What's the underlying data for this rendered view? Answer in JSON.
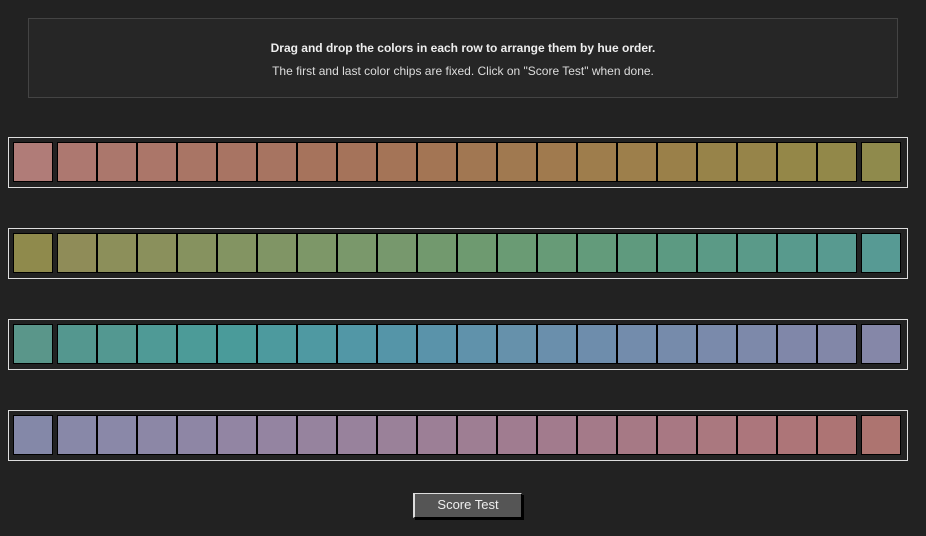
{
  "instructions": {
    "title": "Drag and drop the colors in each row to arrange them by hue order.",
    "subtitle": "The first and last color chips are fixed. Click on \"Score Test\" when done."
  },
  "rows": [
    {
      "chips": [
        "#b07c78",
        "#ad7870",
        "#ab776c",
        "#ab7669",
        "#a97565",
        "#a87463",
        "#a77461",
        "#a6735c",
        "#a5735a",
        "#a47457",
        "#a37554",
        "#a17752",
        "#a07950",
        "#a07a4e",
        "#9e7d4c",
        "#9d7f4b",
        "#9a8049",
        "#978349",
        "#968449",
        "#948748",
        "#928849",
        "#8f8a4c"
      ]
    },
    {
      "chips": [
        "#8f8a4c",
        "#8f8c58",
        "#8c8f5a",
        "#8a905c",
        "#86925f",
        "#839462",
        "#809565",
        "#7d9768",
        "#7a986b",
        "#77986d",
        "#72996e",
        "#6e9a70",
        "#6a9b74",
        "#679b77",
        "#639b7b",
        "#5f9a7e",
        "#5c9a82",
        "#5b9a86",
        "#5a9a89",
        "#589a8d",
        "#589a90",
        "#579a94"
      ]
    },
    {
      "chips": [
        "#5a968a",
        "#54978f",
        "#539891",
        "#4f9a96",
        "#4c9b98",
        "#4a9b9a",
        "#4d9a9e",
        "#4f99a2",
        "#5297a6",
        "#5595a8",
        "#5a93aa",
        "#6092ab",
        "#6691ab",
        "#6a8fac",
        "#6e8dac",
        "#738cac",
        "#768bab",
        "#7a8aab",
        "#7d89aa",
        "#8087a9",
        "#8287a8",
        "#8587a8"
      ]
    },
    {
      "chips": [
        "#8488a8",
        "#8888a8",
        "#8a88a8",
        "#8c87a6",
        "#8e86a5",
        "#9285a3",
        "#9484a1",
        "#96839e",
        "#98829c",
        "#9a8199",
        "#9c7f96",
        "#9e7e93",
        "#a07c90",
        "#a27b8d",
        "#a47a89",
        "#a67985",
        "#a87883",
        "#aa787f",
        "#ac767c",
        "#ad7578",
        "#ad7474",
        "#ad7470"
      ]
    }
  ],
  "score_button": "Score Test"
}
